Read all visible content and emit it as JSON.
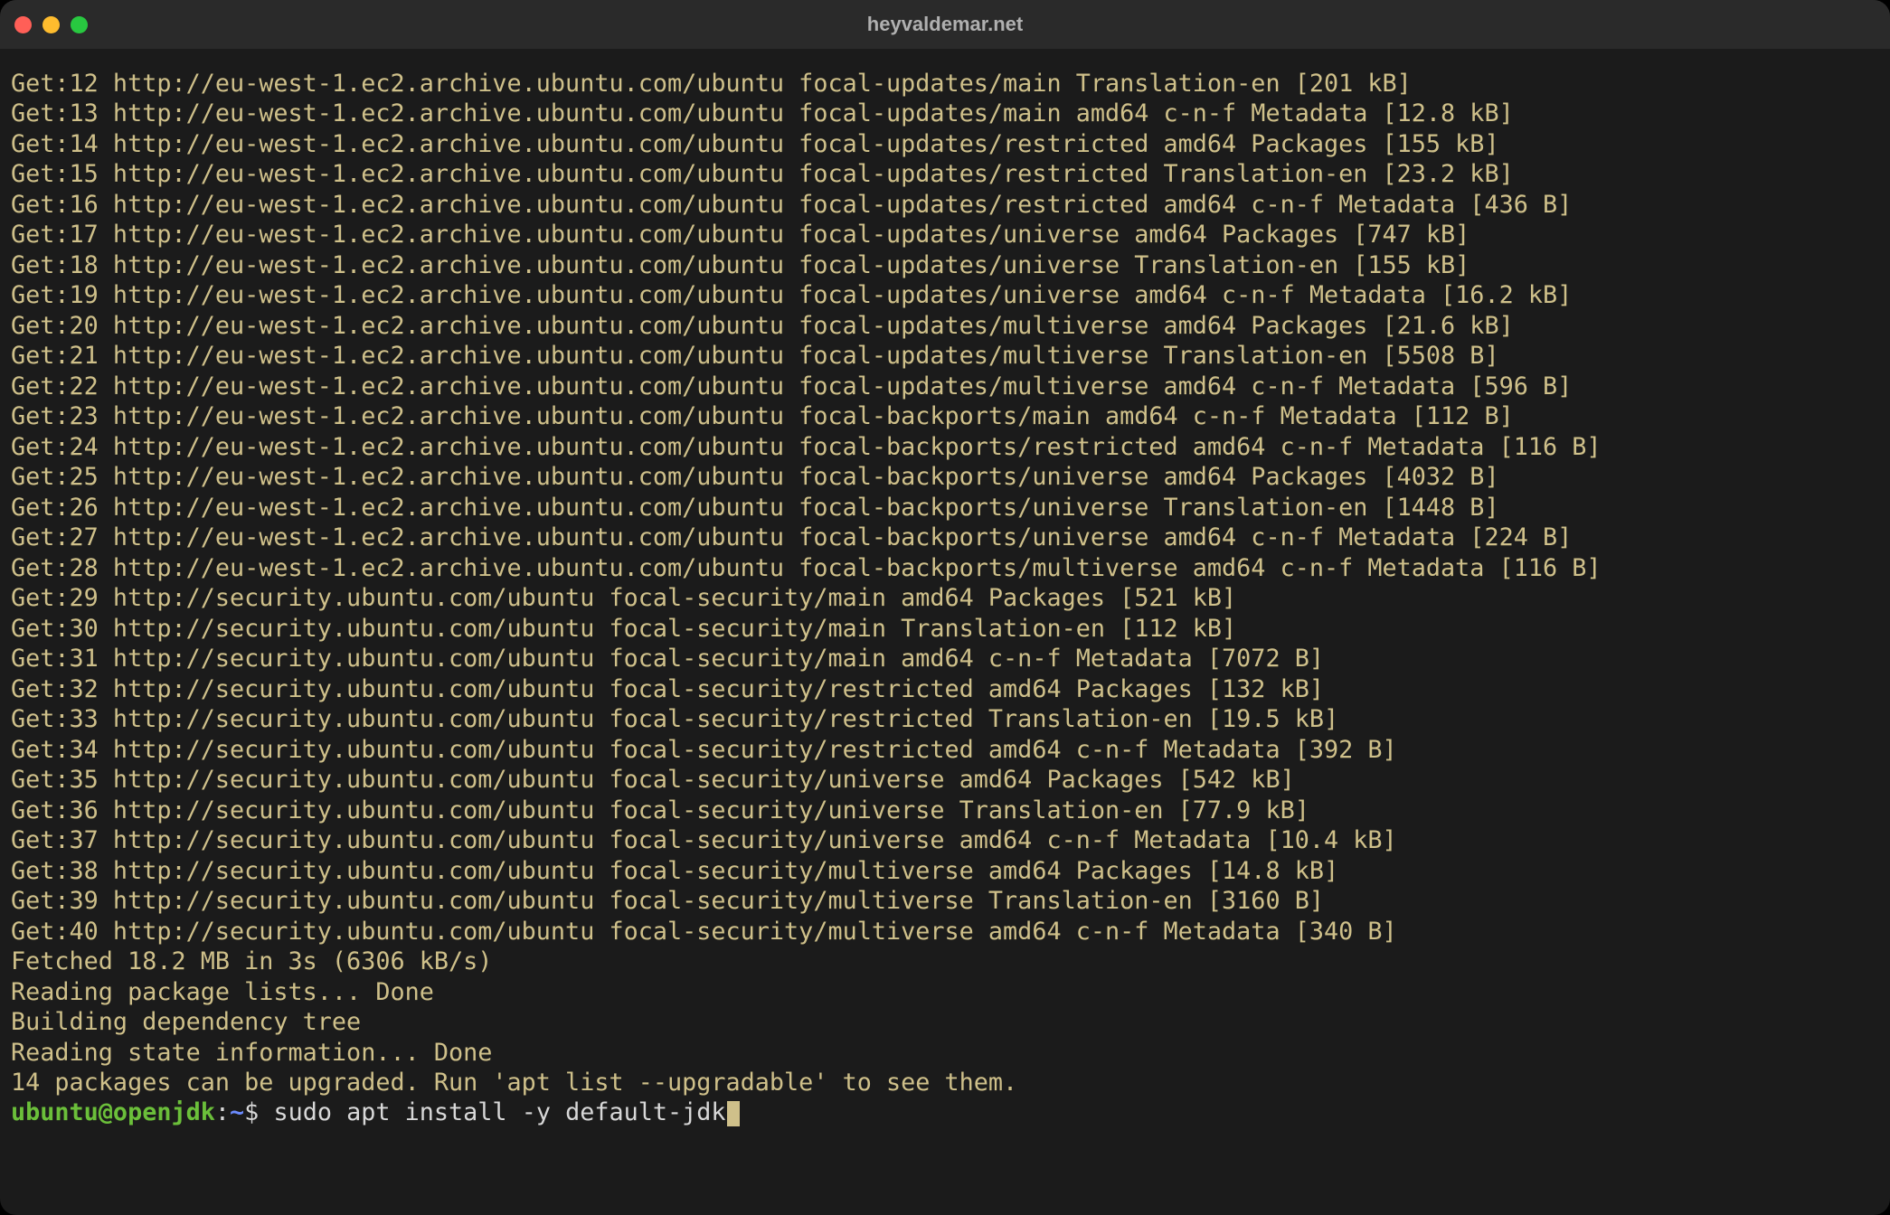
{
  "window": {
    "title": "heyvaldemar.net"
  },
  "terminal": {
    "lines": [
      "Get:12 http://eu-west-1.ec2.archive.ubuntu.com/ubuntu focal-updates/main Translation-en [201 kB]",
      "Get:13 http://eu-west-1.ec2.archive.ubuntu.com/ubuntu focal-updates/main amd64 c-n-f Metadata [12.8 kB]",
      "Get:14 http://eu-west-1.ec2.archive.ubuntu.com/ubuntu focal-updates/restricted amd64 Packages [155 kB]",
      "Get:15 http://eu-west-1.ec2.archive.ubuntu.com/ubuntu focal-updates/restricted Translation-en [23.2 kB]",
      "Get:16 http://eu-west-1.ec2.archive.ubuntu.com/ubuntu focal-updates/restricted amd64 c-n-f Metadata [436 B]",
      "Get:17 http://eu-west-1.ec2.archive.ubuntu.com/ubuntu focal-updates/universe amd64 Packages [747 kB]",
      "Get:18 http://eu-west-1.ec2.archive.ubuntu.com/ubuntu focal-updates/universe Translation-en [155 kB]",
      "Get:19 http://eu-west-1.ec2.archive.ubuntu.com/ubuntu focal-updates/universe amd64 c-n-f Metadata [16.2 kB]",
      "Get:20 http://eu-west-1.ec2.archive.ubuntu.com/ubuntu focal-updates/multiverse amd64 Packages [21.6 kB]",
      "Get:21 http://eu-west-1.ec2.archive.ubuntu.com/ubuntu focal-updates/multiverse Translation-en [5508 B]",
      "Get:22 http://eu-west-1.ec2.archive.ubuntu.com/ubuntu focal-updates/multiverse amd64 c-n-f Metadata [596 B]",
      "Get:23 http://eu-west-1.ec2.archive.ubuntu.com/ubuntu focal-backports/main amd64 c-n-f Metadata [112 B]",
      "Get:24 http://eu-west-1.ec2.archive.ubuntu.com/ubuntu focal-backports/restricted amd64 c-n-f Metadata [116 B]",
      "Get:25 http://eu-west-1.ec2.archive.ubuntu.com/ubuntu focal-backports/universe amd64 Packages [4032 B]",
      "Get:26 http://eu-west-1.ec2.archive.ubuntu.com/ubuntu focal-backports/universe Translation-en [1448 B]",
      "Get:27 http://eu-west-1.ec2.archive.ubuntu.com/ubuntu focal-backports/universe amd64 c-n-f Metadata [224 B]",
      "Get:28 http://eu-west-1.ec2.archive.ubuntu.com/ubuntu focal-backports/multiverse amd64 c-n-f Metadata [116 B]",
      "Get:29 http://security.ubuntu.com/ubuntu focal-security/main amd64 Packages [521 kB]",
      "Get:30 http://security.ubuntu.com/ubuntu focal-security/main Translation-en [112 kB]",
      "Get:31 http://security.ubuntu.com/ubuntu focal-security/main amd64 c-n-f Metadata [7072 B]",
      "Get:32 http://security.ubuntu.com/ubuntu focal-security/restricted amd64 Packages [132 kB]",
      "Get:33 http://security.ubuntu.com/ubuntu focal-security/restricted Translation-en [19.5 kB]",
      "Get:34 http://security.ubuntu.com/ubuntu focal-security/restricted amd64 c-n-f Metadata [392 B]",
      "Get:35 http://security.ubuntu.com/ubuntu focal-security/universe amd64 Packages [542 kB]",
      "Get:36 http://security.ubuntu.com/ubuntu focal-security/universe Translation-en [77.9 kB]",
      "Get:37 http://security.ubuntu.com/ubuntu focal-security/universe amd64 c-n-f Metadata [10.4 kB]",
      "Get:38 http://security.ubuntu.com/ubuntu focal-security/multiverse amd64 Packages [14.8 kB]",
      "Get:39 http://security.ubuntu.com/ubuntu focal-security/multiverse Translation-en [3160 B]",
      "Get:40 http://security.ubuntu.com/ubuntu focal-security/multiverse amd64 c-n-f Metadata [340 B]",
      "Fetched 18.2 MB in 3s (6306 kB/s)",
      "Reading package lists... Done",
      "Building dependency tree",
      "Reading state information... Done",
      "14 packages can be upgraded. Run 'apt list --upgradable' to see them."
    ],
    "prompt": {
      "user_host": "ubuntu@openjdk",
      "colon": ":",
      "path": "~",
      "symbol": "$",
      "command": "sudo apt install -y default-jdk"
    }
  }
}
